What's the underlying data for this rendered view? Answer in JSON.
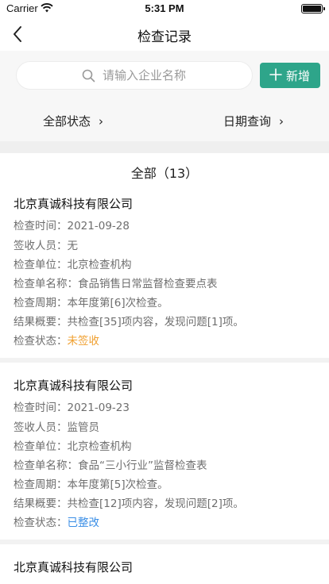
{
  "status_bar": {
    "carrier": "Carrier",
    "time": "5:31 PM"
  },
  "nav": {
    "title": "检查记录"
  },
  "search": {
    "placeholder": "请输入企业名称",
    "value": ""
  },
  "add_button": {
    "label": "新增"
  },
  "filters": {
    "status_label": "全部状态",
    "date_label": "日期查询"
  },
  "list": {
    "section_title": "全部（13）"
  },
  "field_labels": {
    "check_time": "检查时间：",
    "signer": "签收人员：",
    "unit": "检查单位：",
    "form_name": "检查单名称：",
    "period": "检查周期：",
    "summary": "结果概要：",
    "status": "检查状态："
  },
  "records": [
    {
      "company": "北京真诚科技有限公司",
      "check_time": "2021-09-28",
      "signer": "无",
      "unit": "北京检查机构",
      "form_name": "食品销售日常监督检查要点表",
      "period": "本年度第[6]次检查。",
      "summary": "共检查[35]项内容，发现问题[1]项。",
      "status": "未签收"
    },
    {
      "company": "北京真诚科技有限公司",
      "check_time": "2021-09-23",
      "signer": "监管员",
      "unit": "北京检查机构",
      "form_name": "食品“三小行业”监督检查表",
      "period": "本年度第[5]次检查。",
      "summary": "共检查[12]项内容，发现问题[2]项。",
      "status": "已整改"
    },
    {
      "company": "北京真诚科技有限公司"
    }
  ],
  "colors": {
    "accent": "#2ea58a",
    "status_pending": "#f0a030",
    "status_fixed": "#3a8ee6"
  }
}
